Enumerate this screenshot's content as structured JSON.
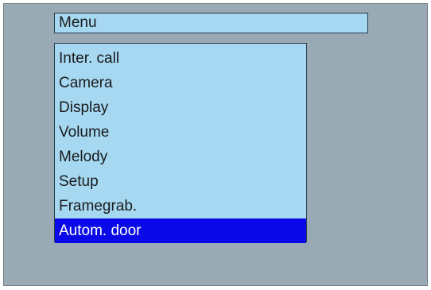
{
  "menu": {
    "title": "Menu",
    "items": [
      {
        "label": "Inter. call",
        "selected": false
      },
      {
        "label": "Camera",
        "selected": false
      },
      {
        "label": "Display",
        "selected": false
      },
      {
        "label": "Volume",
        "selected": false
      },
      {
        "label": "Melody",
        "selected": false
      },
      {
        "label": "Setup",
        "selected": false
      },
      {
        "label": "Framegrab.",
        "selected": false
      },
      {
        "label": "Autom. door",
        "selected": true
      }
    ]
  },
  "colors": {
    "screen_background": "#99aab5",
    "menu_background": "#a6d8f2",
    "selection_background": "#0a0ae8",
    "selection_text": "#ffffff",
    "text": "#1a1a1a"
  }
}
